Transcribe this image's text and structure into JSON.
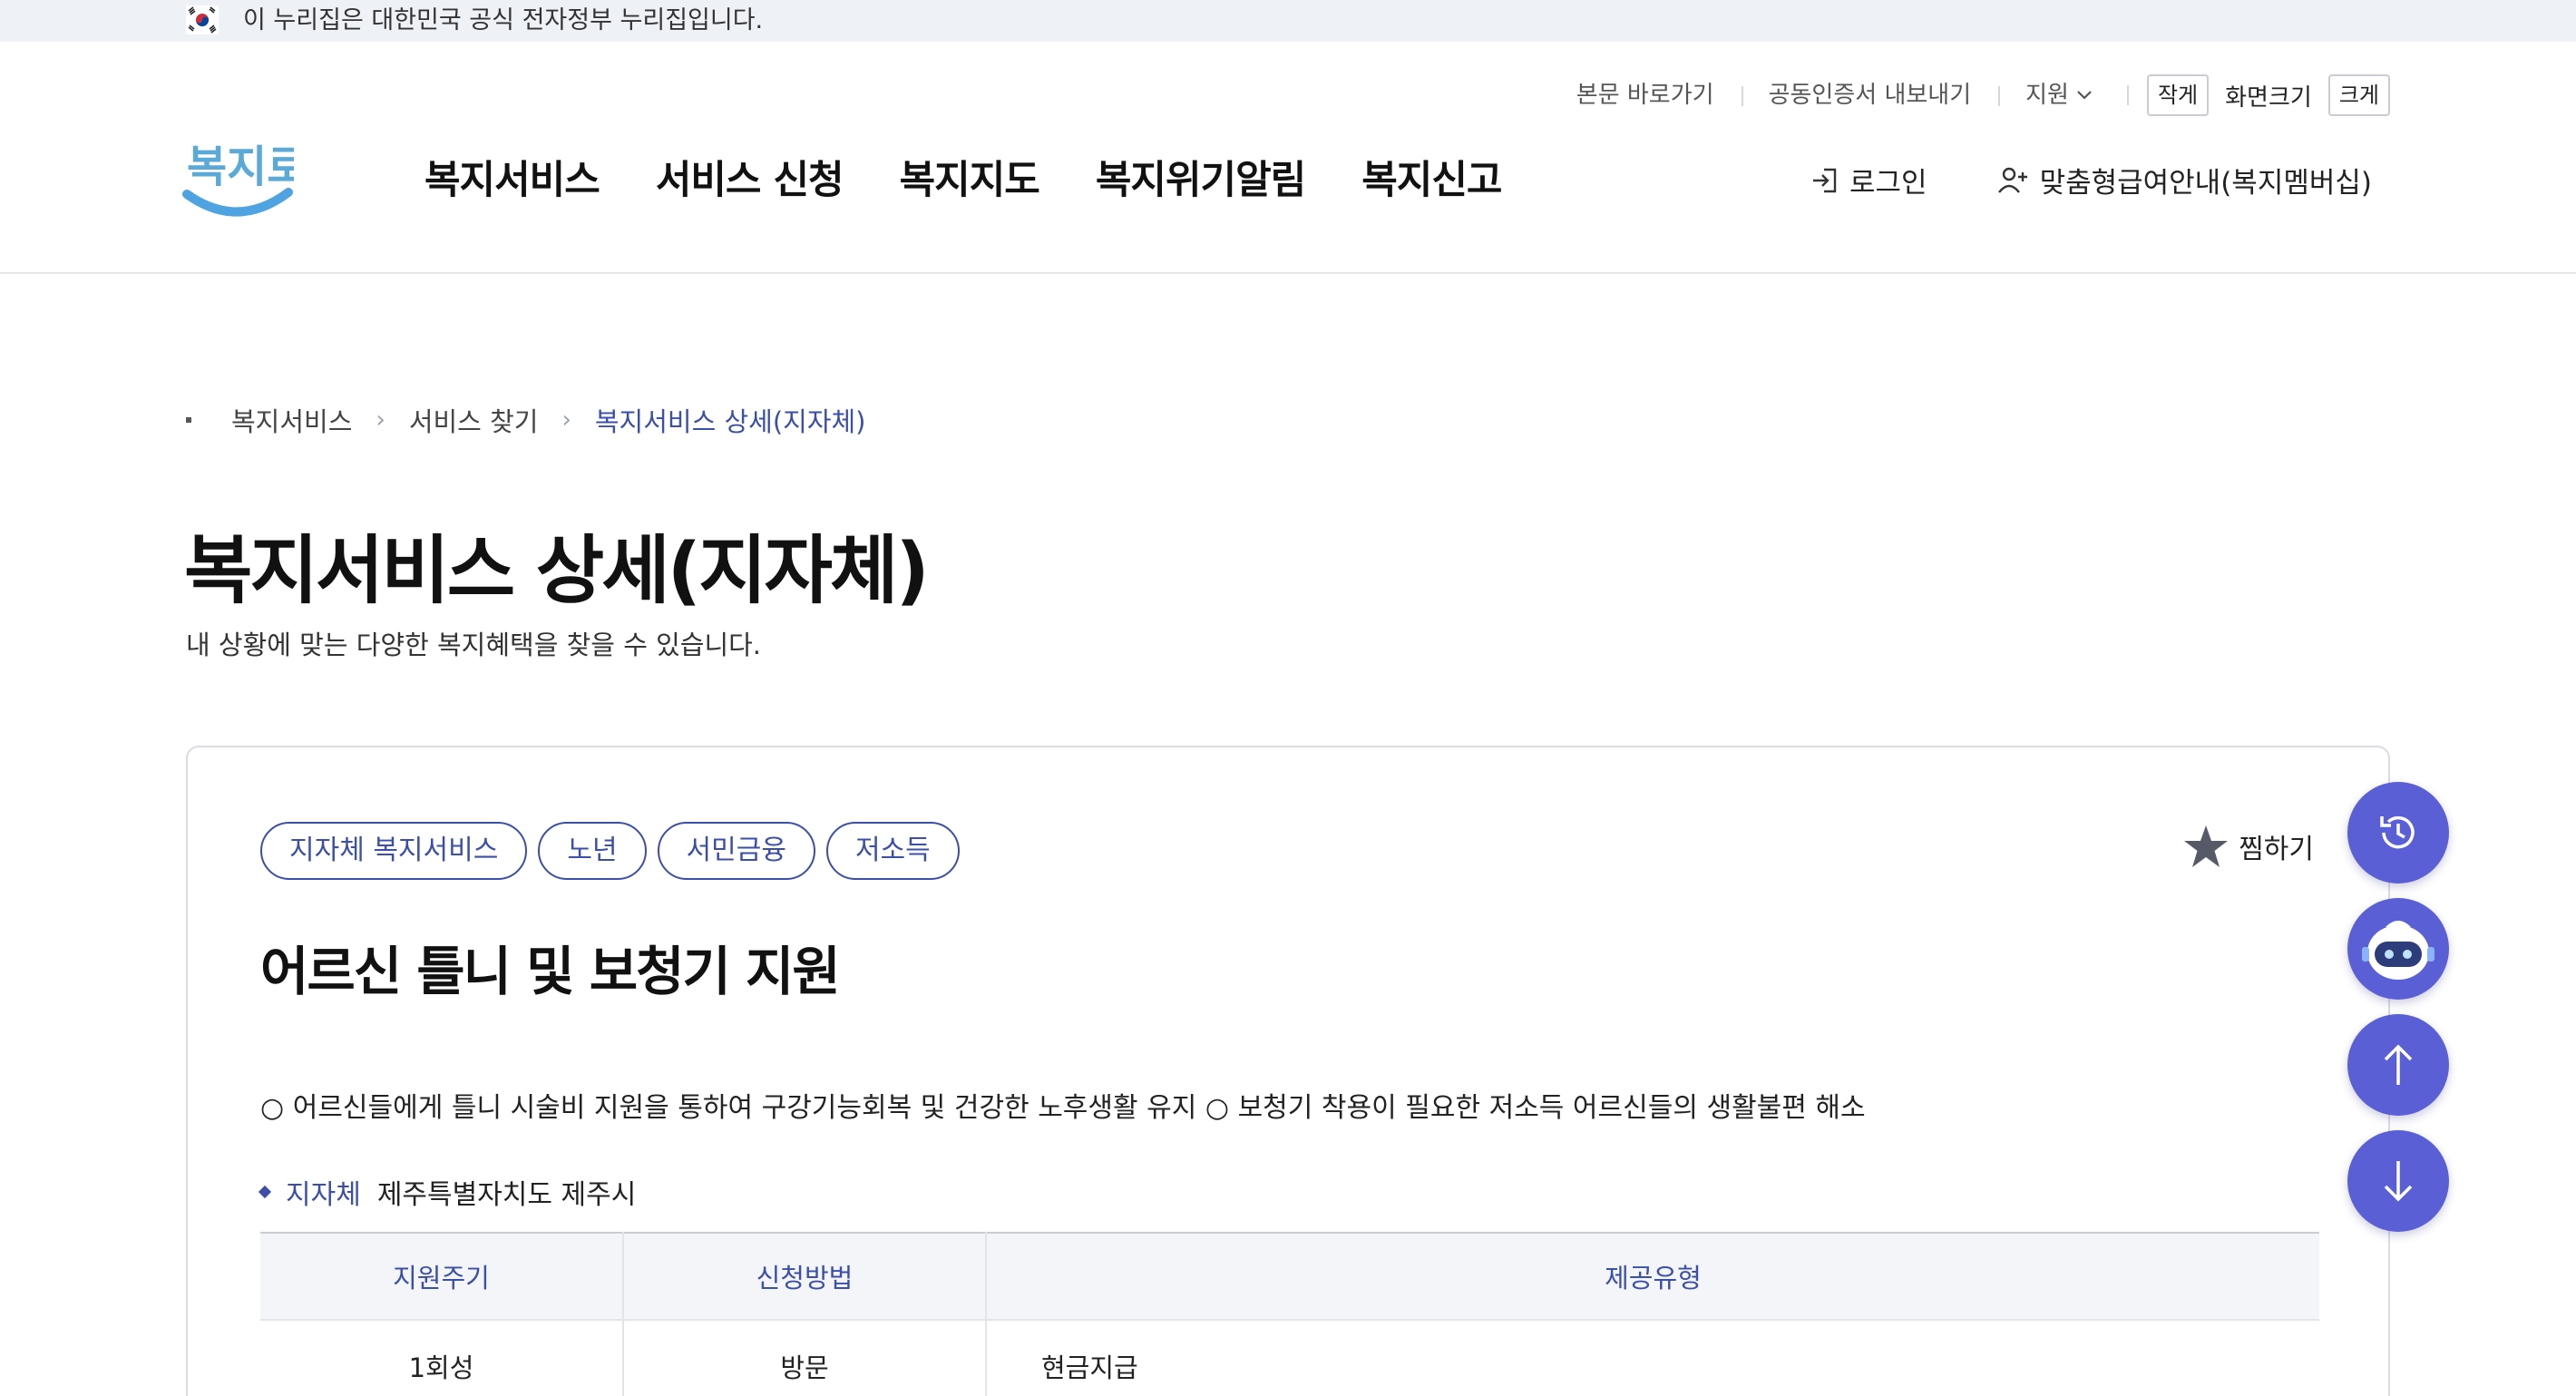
{
  "gov_banner": {
    "text": "이 누리집은 대한민국 공식 전자정부 누리집입니다."
  },
  "utility": {
    "skip": "본문 바로가기",
    "cert": "공동인증서 내보내기",
    "support": "지원",
    "small": "작게",
    "screen_size": "화면크기",
    "large": "크게"
  },
  "logo": {
    "text": "복지로"
  },
  "gnb": [
    "복지서비스",
    "서비스 신청",
    "복지지도",
    "복지위기알림",
    "복지신고"
  ],
  "member": {
    "login": "로그인",
    "membership": "맞춤형급여안내(복지멤버십)"
  },
  "breadcrumb": {
    "items": [
      "복지서비스",
      "서비스 찾기"
    ],
    "current": "복지서비스 상세(지자체)"
  },
  "page": {
    "title": "복지서비스 상세(지자체)",
    "description": "내 상황에 맞는 다양한 복지혜택을 찾을 수 있습니다."
  },
  "service": {
    "tags": [
      "지자체 복지서비스",
      "노년",
      "서민금융",
      "저소득"
    ],
    "favorite": "찜하기",
    "title": "어르신 틀니 및 보청기 지원",
    "description": "○ 어르신들에게 틀니 시술비 지원을 통하여 구강기능회복 및 건강한 노후생활 유지 ○ 보청기 착용이 필요한 저소득 어르신들의 생활불편 해소",
    "org_label": "지자체",
    "org_value": "제주특별자치도 제주시",
    "table": {
      "headers": [
        "지원주기",
        "신청방법",
        "제공유형"
      ],
      "row": [
        "1회성",
        "방문",
        "현금지급"
      ]
    }
  },
  "colors": {
    "primary": "#3b4fa8",
    "float_button": "#5b5fd6",
    "banner_bg": "#eef1f6"
  },
  "floating_buttons": [
    "history-icon",
    "chatbot-icon",
    "arrow-up-icon",
    "arrow-down-icon"
  ]
}
